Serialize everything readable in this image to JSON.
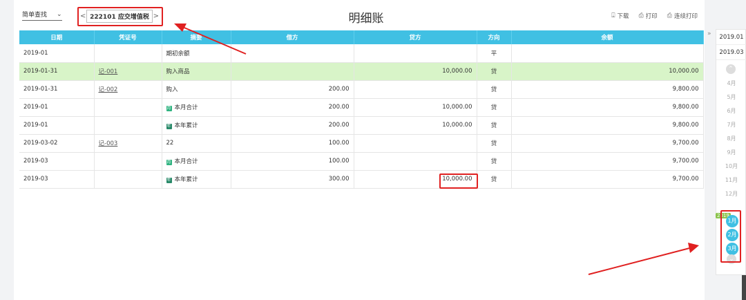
{
  "header": {
    "search_mode": "简单查找",
    "account": "222101 应交增值税",
    "prev": "<",
    "next": ">",
    "title": "明细账",
    "actions": [
      {
        "label": "下载",
        "icon": "download-icon"
      },
      {
        "label": "打印",
        "icon": "print-icon"
      },
      {
        "label": "连续打印",
        "icon": "batch-print-icon"
      }
    ]
  },
  "table": {
    "columns": [
      "日期",
      "凭证号",
      "摘要",
      "借方",
      "贷方",
      "方向",
      "余额"
    ],
    "rows": [
      {
        "date": "2019-01",
        "voucher": "",
        "summary": "期初余额",
        "tag": "",
        "debit": "",
        "credit": "",
        "dir": "平",
        "balance": "",
        "highlight": false
      },
      {
        "date": "2019-01-31",
        "voucher": "记-001",
        "summary": "购入商品",
        "tag": "",
        "debit": "",
        "credit": "10,000.00",
        "dir": "贷",
        "balance": "10,000.00",
        "highlight": true
      },
      {
        "date": "2019-01-31",
        "voucher": "记-002",
        "summary": "购入",
        "tag": "",
        "debit": "200.00",
        "credit": "",
        "dir": "贷",
        "balance": "9,800.00",
        "highlight": false
      },
      {
        "date": "2019-01",
        "voucher": "",
        "summary": "本月合计",
        "tag": "月",
        "debit": "200.00",
        "credit": "10,000.00",
        "dir": "贷",
        "balance": "9,800.00",
        "highlight": false
      },
      {
        "date": "2019-01",
        "voucher": "",
        "summary": "本年累计",
        "tag": "年",
        "debit": "200.00",
        "credit": "10,000.00",
        "dir": "贷",
        "balance": "9,800.00",
        "highlight": false
      },
      {
        "date": "2019-03-02",
        "voucher": "记-003",
        "summary": "22",
        "tag": "",
        "debit": "100.00",
        "credit": "",
        "dir": "贷",
        "balance": "9,700.00",
        "highlight": false
      },
      {
        "date": "2019-03",
        "voucher": "",
        "summary": "本月合计",
        "tag": "月",
        "debit": "100.00",
        "credit": "",
        "dir": "贷",
        "balance": "9,700.00",
        "highlight": false
      },
      {
        "date": "2019-03",
        "voucher": "",
        "summary": "本年累计",
        "tag": "年",
        "debit": "300.00",
        "credit": "10,000.00",
        "dir": "贷",
        "balance": "9,700.00",
        "highlight": false
      }
    ]
  },
  "sidebar": {
    "collapse": "»",
    "period_start": "2019.01",
    "period_end": "2019.03",
    "months_inactive": [
      "4月",
      "5月",
      "6月",
      "7月",
      "8月",
      "9月",
      "10月",
      "11月",
      "12月"
    ],
    "year_badge": "2019",
    "months_active": [
      "1月",
      "2月",
      "3月"
    ]
  },
  "colors": {
    "header_bg": "#40c0e3",
    "highlight_row": "#d8f4c8",
    "annotation": "#e02020"
  }
}
